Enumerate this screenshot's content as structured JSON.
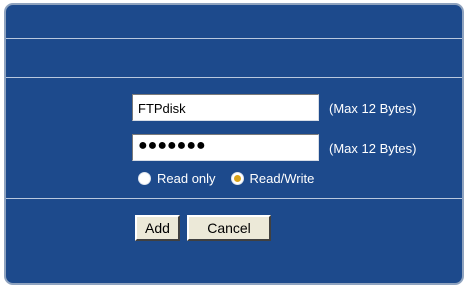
{
  "form": {
    "name_value": "FTPdisk",
    "password_value": "●●●●●●●",
    "name_hint": "(Max 12 Bytes)",
    "password_hint": "(Max 12 Bytes)",
    "access": {
      "options": [
        "Read only",
        "Read/Write"
      ],
      "selected": "Read/Write"
    }
  },
  "buttons": {
    "add_label": "Add",
    "cancel_label": "Cancel"
  },
  "colors": {
    "panel_background": "#1d4a8c",
    "panel_border": "#8fa3bf",
    "divider": "#b9c8de",
    "radio_selected_dot": "#d9a31a"
  }
}
